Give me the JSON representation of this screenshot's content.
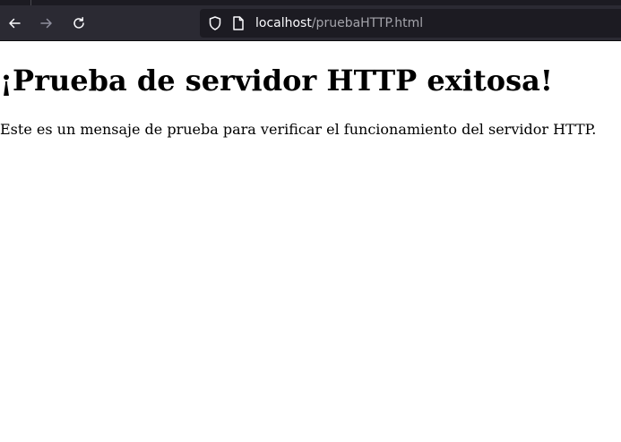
{
  "toolbar": {
    "url_host": "localhost",
    "url_path": "/pruebaHTTP.html",
    "icons": {
      "back": "arrow-left-icon",
      "forward": "arrow-right-icon",
      "reload": "reload-icon",
      "shield": "shield-icon",
      "page": "page-icon"
    }
  },
  "page": {
    "heading": "¡Prueba de servidor HTTP exitosa!",
    "message": "Este es un mensaje de prueba para verificar el funcionamiento del servidor HTTP."
  },
  "colors": {
    "toolbar_bg": "#2b2a33",
    "urlbar_bg": "#1c1b22",
    "url_host": "#fbfbfe",
    "url_path": "#a4a4ab",
    "page_bg": "#ffffff"
  }
}
